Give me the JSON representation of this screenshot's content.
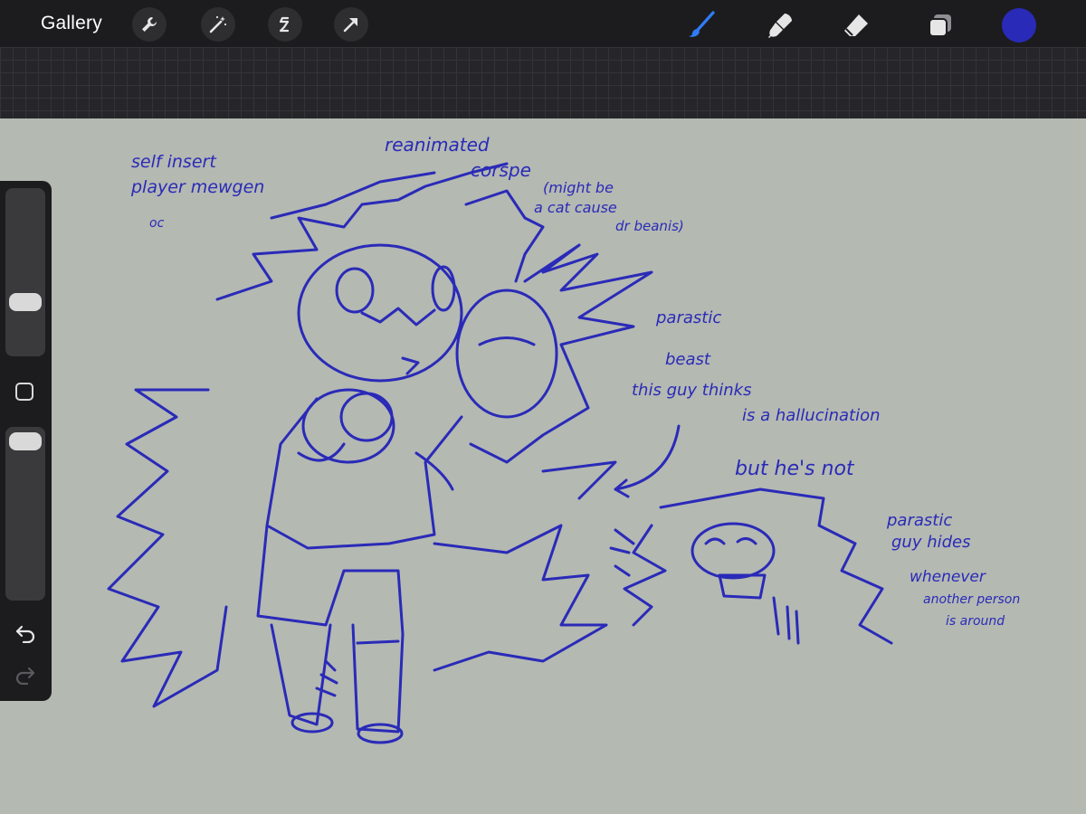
{
  "toolbar": {
    "gallery_label": "Gallery",
    "left_tools": [
      "wrench-icon",
      "magic-wand-icon",
      "selection-icon",
      "transform-arrow-icon"
    ],
    "right_tools": [
      "brush-icon",
      "smudge-icon",
      "eraser-icon",
      "layers-icon"
    ],
    "current_color": "#2a2ab8",
    "active_tool": "brush"
  },
  "sidebar": {
    "brush_size_level": 0.78,
    "opacity_level": 0.93,
    "modifier_icon": "square-modifier-icon",
    "undo_icon": "undo-arrow-icon",
    "redo_icon": "redo-arrow-icon"
  },
  "canvas": {
    "background": "#b4b9b2",
    "ink_color": "#2a2ab8",
    "notes": {
      "self_insert_1": "self insert",
      "self_insert_2": "player mewgen",
      "self_insert_3": "oc",
      "reanimated_1": "reanimated",
      "reanimated_2": "corspe",
      "might_be_1": "(might be",
      "might_be_2": "a cat cause",
      "might_be_3": "dr beanis)",
      "parastic_1": "parastic",
      "parastic_2": "beast",
      "parastic_3": "this guy thinks",
      "parastic_4": "is a hallucination",
      "but_not": "but he's not",
      "hides_1": "parastic",
      "hides_2": "guy hides",
      "hides_3": "whenever",
      "hides_4": "another person",
      "hides_5": "is around"
    }
  }
}
